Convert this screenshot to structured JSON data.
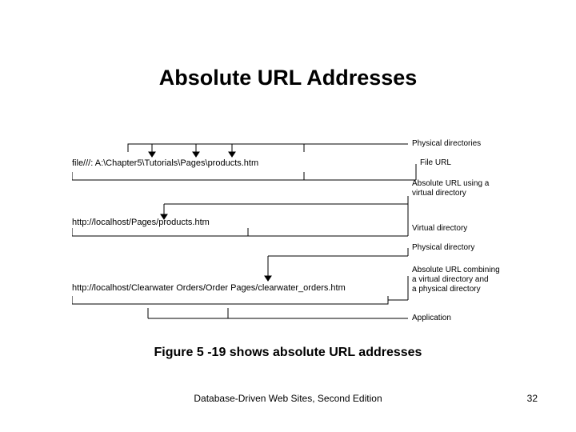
{
  "title": "Absolute URL Addresses",
  "caption": "Figure 5 -19 shows absolute URL addresses",
  "footer": {
    "center": "Database-Driven Web Sites, Second Edition",
    "page": "32"
  },
  "urls": {
    "file_url": "file///: A:\\Chapter5\\Tutorials\\Pages\\products.htm",
    "localhost_url": "http://localhost/Pages/products.htm",
    "clearwater_url": "http://localhost/Clearwater Orders/Order Pages/clearwater_orders.htm"
  },
  "labels": {
    "physical_dirs": "Physical directories",
    "file_url_label": "File URL",
    "abs_virtual": "Absolute URL using a\nvirtual directory",
    "virtual_dir": "Virtual directory",
    "physical_dir": "Physical directory",
    "abs_combining": "Absolute URL combining\na virtual directory and\na physical directory",
    "application": "Application"
  }
}
